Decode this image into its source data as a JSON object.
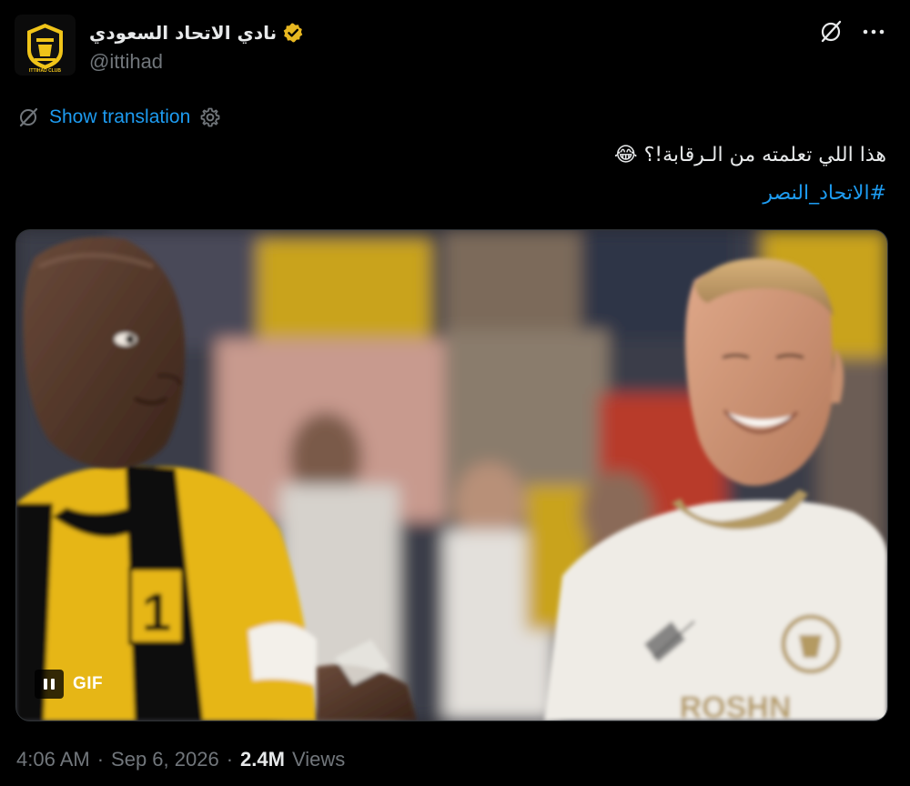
{
  "author": {
    "display_name": "نادي الاتحاد السعودي",
    "handle": "@ittihad",
    "verified_color": "#e8b720",
    "avatar_badge_text": "ITTIHAD CLUB"
  },
  "actions": {
    "grok_icon": "grok-slash-icon",
    "more_icon": "more-dots-icon",
    "more_label": "···"
  },
  "translation": {
    "link_label": "Show translation"
  },
  "tweet": {
    "text": "هذا اللي تعلمته من الـرقابة!؟ 😂",
    "hashtag": "#الاتحاد_النصر"
  },
  "media": {
    "gif_label": "GIF",
    "pause_icon": "pause-icon",
    "kit_text": "1",
    "shirt_text": "ROSHN"
  },
  "meta": {
    "time": "4:06 AM",
    "sep1": "·",
    "date": "Sep 6, 2026",
    "sep2": "·",
    "views_count": "2.4M",
    "views_label": "Views"
  },
  "colors": {
    "background": "#000000",
    "text_primary": "#e7e9ea",
    "text_secondary": "#71767b",
    "link": "#1d9bf0",
    "ittihad_yellow": "#f0c419"
  }
}
